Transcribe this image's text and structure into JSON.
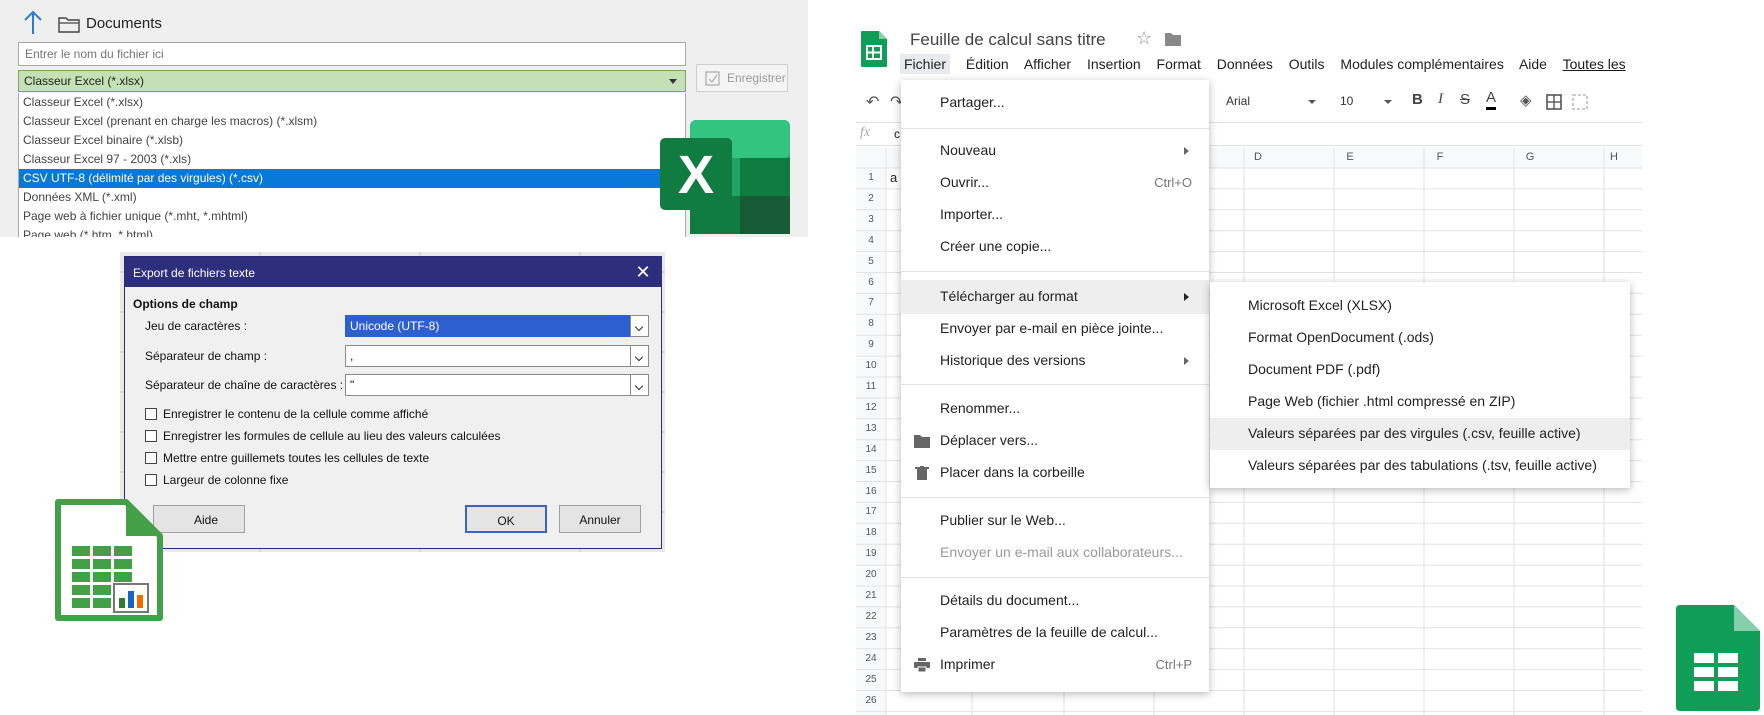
{
  "excel": {
    "folder_name": "Documents",
    "filename_placeholder": "Entrer le nom du fichier ici",
    "selected_format": "Classeur Excel (*.xlsx)",
    "formats": [
      "Classeur Excel (*.xlsx)",
      "Classeur Excel (prenant en charge les macros) (*.xlsm)",
      "Classeur Excel binaire (*.xlsb)",
      "Classeur Excel 97 - 2003 (*.xls)",
      "CSV UTF-8 (délimité par des virgules) (*.csv)",
      "Données XML (*.xml)",
      "Page web à fichier unique (*.mht, *.mhtml)",
      "Page web (*.htm, *.html)"
    ],
    "highlighted_index": 4,
    "save_label": "Enregistrer",
    "logo_letter": "X"
  },
  "lo_dialog": {
    "title": "Export de fichiers texte",
    "section": "Options de champ",
    "charset_label": "Jeu de caractères :",
    "charset_value": "Unicode (UTF-8)",
    "field_sep_label": "Séparateur de champ :",
    "field_sep_value": ",",
    "string_sep_label": "Séparateur de chaîne de caractères :",
    "string_sep_value": "\"",
    "checkboxes": [
      "Enregistrer le contenu de la cellule comme affiché",
      "Enregistrer les formules de cellule au lieu des valeurs calculées",
      "Mettre entre guillemets toutes les cellules de texte",
      "Largeur de colonne fixe"
    ],
    "help_label": "Aide",
    "ok_label": "OK",
    "cancel_label": "Annuler"
  },
  "sheets": {
    "title": "Feuille de calcul sans titre",
    "menu": [
      "Fichier",
      "Édition",
      "Afficher",
      "Insertion",
      "Format",
      "Données",
      "Outils",
      "Modules complémentaires",
      "Aide"
    ],
    "menu_link": "Toutes les",
    "font": "Arial",
    "font_size": "10",
    "formula_value": "c",
    "cell_a1": "a",
    "columns": [
      "D",
      "E",
      "F",
      "G",
      "H"
    ],
    "rows": [
      "1",
      "2",
      "3",
      "4",
      "5",
      "6",
      "7",
      "8",
      "9",
      "10",
      "11",
      "12",
      "13",
      "14",
      "15",
      "16",
      "17",
      "18",
      "19",
      "20",
      "21",
      "22",
      "23",
      "24",
      "25",
      "26"
    ],
    "file_menu": {
      "share": "Partager...",
      "new": "Nouveau",
      "open": "Ouvrir...",
      "open_shortcut": "Ctrl+O",
      "import": "Importer...",
      "copy": "Créer une copie...",
      "download": "Télécharger au format",
      "email_attach": "Envoyer par e-mail en pièce jointe...",
      "history": "Historique des versions",
      "rename": "Renommer...",
      "move": "Déplacer vers...",
      "trash": "Placer dans la corbeille",
      "publish": "Publier sur le Web...",
      "email_collab": "Envoyer un e-mail aux collaborateurs...",
      "details": "Détails du document...",
      "settings": "Paramètres de la feuille de calcul...",
      "print": "Imprimer",
      "print_shortcut": "Ctrl+P"
    },
    "download_menu": [
      "Microsoft Excel (XLSX)",
      "Format OpenDocument (.ods)",
      "Document PDF (.pdf)",
      "Page Web (fichier .html compressé en ZIP)",
      "Valeurs séparées par des virgules (.csv, feuille active)",
      "Valeurs séparées par des tabulations (.tsv, feuille active)"
    ],
    "download_highlighted_index": 4
  }
}
